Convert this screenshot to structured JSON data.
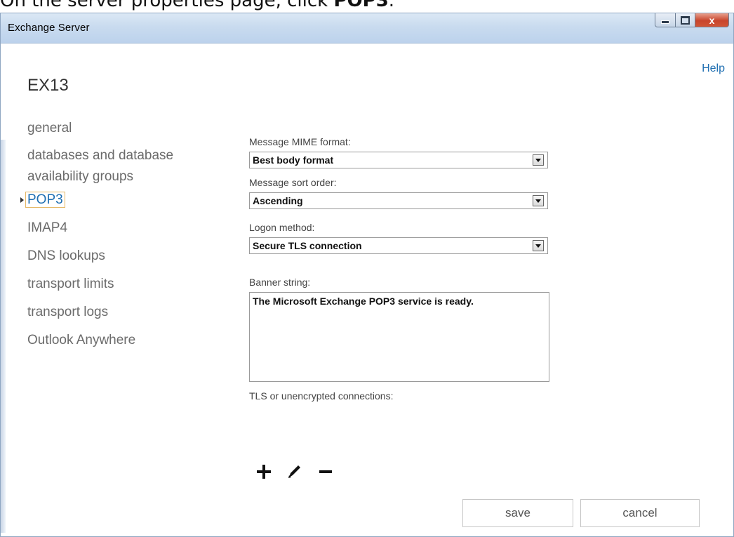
{
  "caption": {
    "prefix": "On the server properties page, click ",
    "bold": "POP3",
    "suffix": "."
  },
  "window": {
    "title": "Exchange Server",
    "close_glyph": "x",
    "help_link": "Help",
    "server_name": "EX13"
  },
  "nav": {
    "items": [
      {
        "label": "general"
      },
      {
        "label": "databases and database availability groups",
        "line1": "databases and database",
        "line2": "availability groups"
      },
      {
        "label": "POP3",
        "active": true
      },
      {
        "label": "IMAP4"
      },
      {
        "label": "DNS lookups"
      },
      {
        "label": "transport limits"
      },
      {
        "label": "transport logs"
      },
      {
        "label": "Outlook Anywhere"
      }
    ]
  },
  "form": {
    "mime_label": "Message MIME format:",
    "mime_value": "Best body format",
    "sort_label": "Message sort order:",
    "sort_value": "Ascending",
    "logon_label": "Logon method:",
    "logon_value": "Secure TLS connection",
    "banner_label": "Banner string:",
    "banner_value": "The Microsoft Exchange POP3 service is ready.",
    "connections_label": "TLS or unencrypted connections:"
  },
  "toolbar": {
    "icons": [
      "add-icon",
      "edit-icon",
      "remove-icon"
    ]
  },
  "buttons": {
    "save": "save",
    "cancel": "cancel"
  }
}
